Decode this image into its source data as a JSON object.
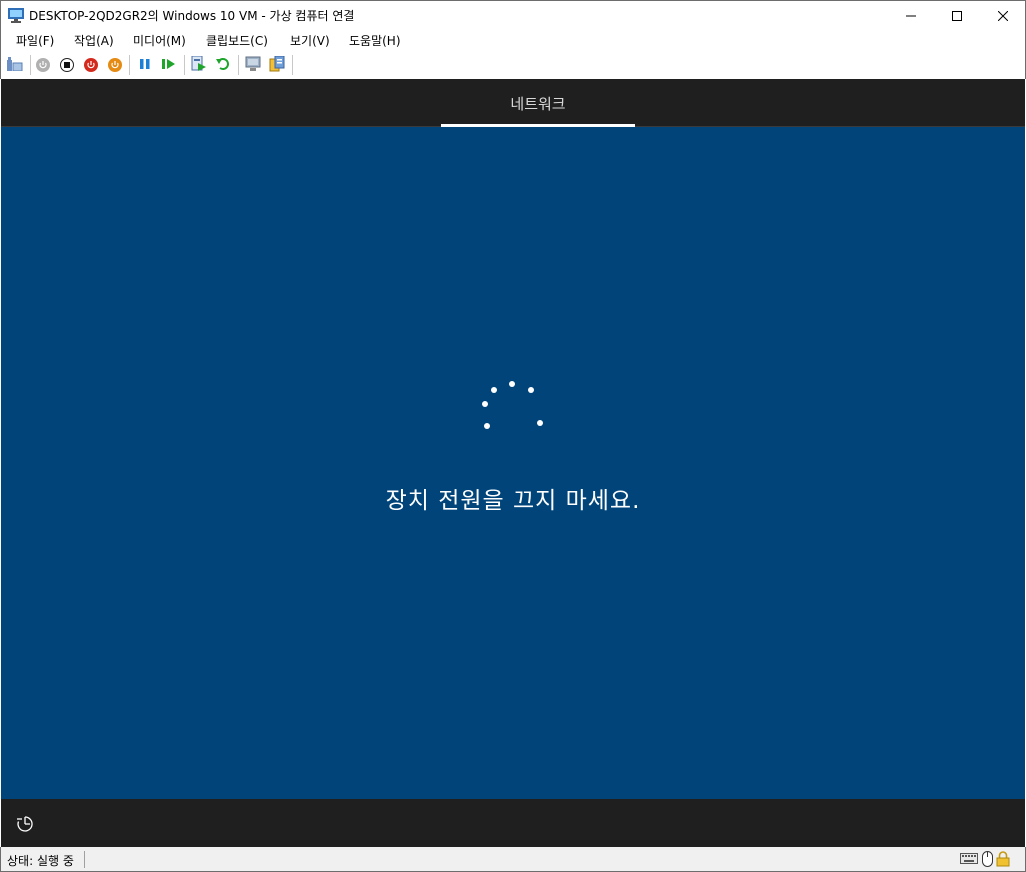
{
  "window": {
    "title": "DESKTOP-2QD2GR2의 Windows 10 VM - 가상 컴퓨터 연결",
    "minimize_icon": "minimize-icon",
    "maximize_icon": "maximize-icon",
    "close_icon": "close-icon"
  },
  "menu": {
    "items": [
      {
        "label": "파일(F)"
      },
      {
        "label": "작업(A)"
      },
      {
        "label": "미디어(M)"
      },
      {
        "label": "클립보드(C)"
      },
      {
        "label": "보기(V)"
      },
      {
        "label": "도움말(H)"
      }
    ]
  },
  "toolbar": {
    "buttons": [
      {
        "icon": "ctrl-alt-del-icon"
      },
      {
        "icon": "start-icon"
      },
      {
        "icon": "turn-off-icon"
      },
      {
        "icon": "shutdown-icon"
      },
      {
        "icon": "power-icon"
      },
      {
        "icon": "pause-icon"
      },
      {
        "icon": "resume-icon"
      },
      {
        "icon": "checkpoint-icon"
      },
      {
        "icon": "revert-icon"
      },
      {
        "icon": "enhanced-session-icon"
      },
      {
        "icon": "share-icon"
      }
    ]
  },
  "vm": {
    "tab_label": "네트워크",
    "message": "장치 전원을 끄지 마세요.",
    "background_color": "#00447a",
    "header_color": "#1f1f1f"
  },
  "status": {
    "text": "상태: 실행 중",
    "icons": [
      "keyboard-icon",
      "mouse-icon",
      "lock-icon"
    ]
  }
}
